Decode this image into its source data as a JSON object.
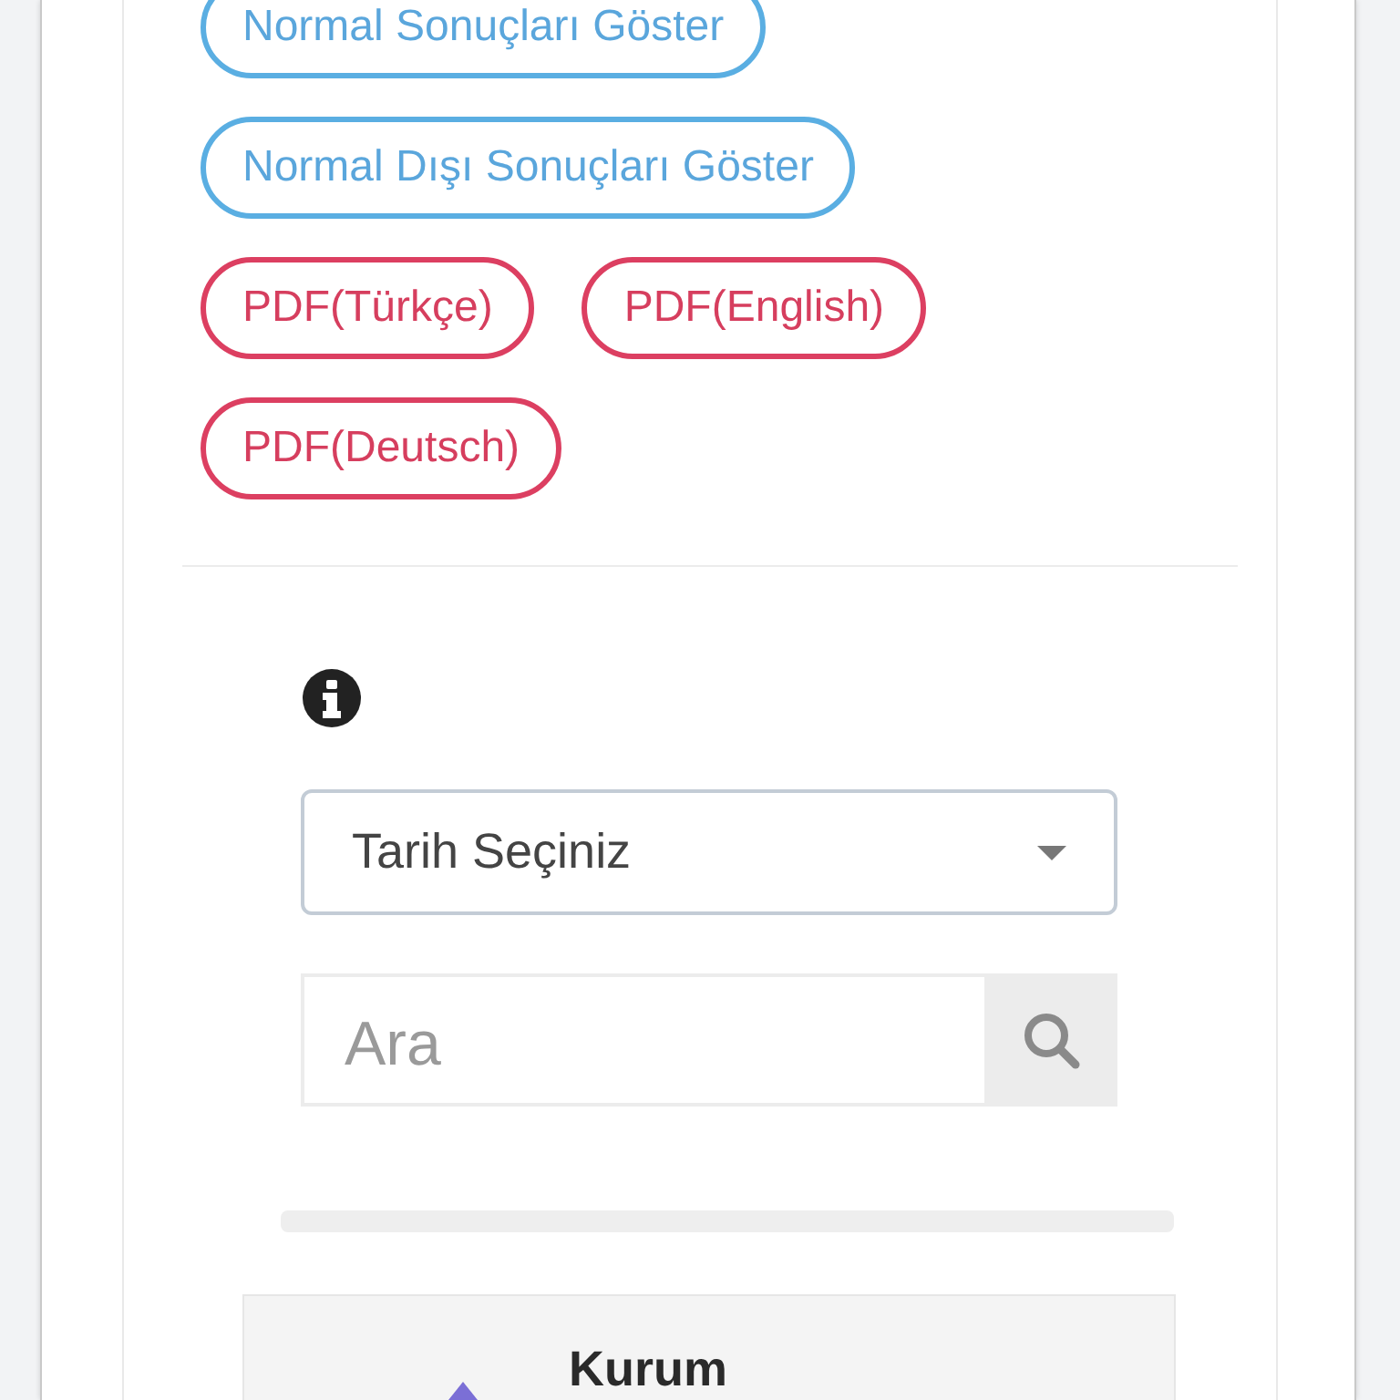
{
  "actions": [
    {
      "label": "Normal Sonuçları Göster",
      "kind": "filter"
    },
    {
      "label": "Normal Dışı Sonuçları Göster",
      "kind": "filter"
    },
    {
      "label": "PDF(Türkçe)",
      "kind": "pdf"
    },
    {
      "label": "PDF(English)",
      "kind": "pdf"
    },
    {
      "label": "PDF(Deutsch)",
      "kind": "pdf"
    }
  ],
  "filters": {
    "date_select": {
      "selected_option": "Tarih Seçiniz"
    },
    "search": {
      "placeholder": "Ara"
    }
  },
  "result_card": {
    "title": "Kurum"
  }
}
